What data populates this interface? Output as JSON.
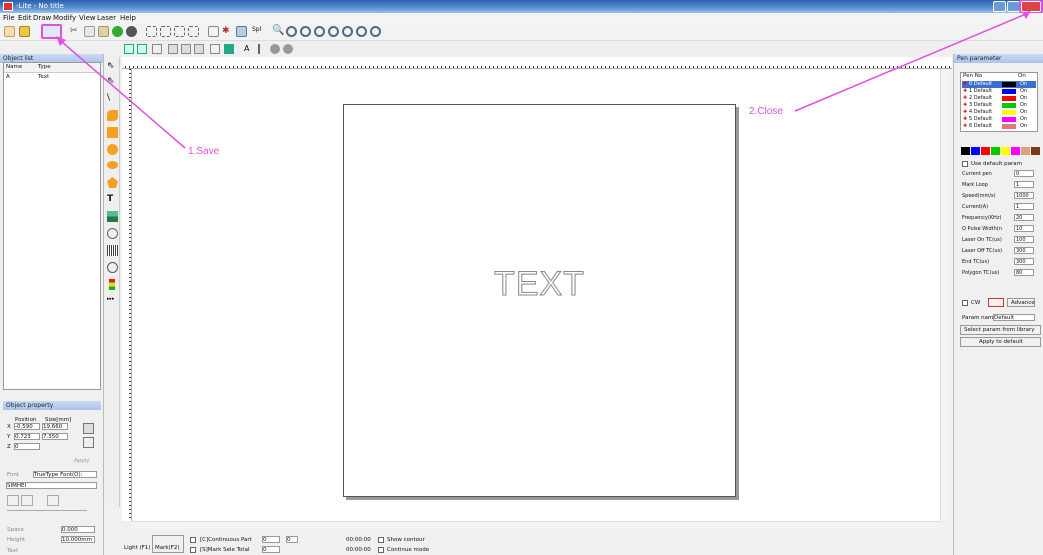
{
  "window": {
    "title": "-Lite - No title"
  },
  "menu": [
    "File",
    "Edit",
    "Draw",
    "Modify",
    "View",
    "Laser",
    "Help"
  ],
  "object_list": {
    "header": "Object list",
    "columns": [
      "Name",
      "Type"
    ],
    "rows": [
      {
        "name": "A",
        "type": "Text"
      }
    ]
  },
  "object_property": {
    "header": "Object property",
    "position_label": "Position",
    "size_label": "Size[mm]",
    "x_label": "X",
    "y_label": "Y",
    "z_label": "Z",
    "x_pos": "-0.590",
    "x_size": "19.660",
    "y_pos": "0.723",
    "y_size": "7.350",
    "z_pos": "0",
    "apply_label": "Apply",
    "font_label": "Font",
    "font_value": "TrueType Font(O):",
    "font_name": "SIMHEI",
    "space_label": "Space",
    "space_value": "0.000",
    "height_label": "Height",
    "height_value": "10.000mm",
    "text_label": "Text"
  },
  "canvas": {
    "object_text": "TEXT"
  },
  "bottom": {
    "light_label": "Light (F1)",
    "mark_label": "Mark(F2)",
    "continuous_label": "[C]Continuous Part",
    "part_value": "0",
    "part_extra": "0",
    "mark_sel_label": "[S]Mark Sele Total",
    "total_value": "0",
    "time1": "00:00:00",
    "time2": "00:00:00",
    "show_contour_label": "Show contour",
    "continue_mode_label": "Continue mode"
  },
  "pen_param": {
    "header": "Pen parameter",
    "columns": [
      "Pen No",
      "",
      "On"
    ],
    "pens": [
      {
        "name": "0 Default",
        "color": "#000000",
        "on": "On"
      },
      {
        "name": "1 Default",
        "color": "#0000ff",
        "on": "On"
      },
      {
        "name": "2 Default",
        "color": "#ff0000",
        "on": "On"
      },
      {
        "name": "3 Default",
        "color": "#00cc00",
        "on": "On"
      },
      {
        "name": "4 Default",
        "color": "#ffff00",
        "on": "On"
      },
      {
        "name": "5 Default",
        "color": "#ff00ff",
        "on": "On"
      },
      {
        "name": "6 Default",
        "color": "#e07a7a",
        "on": "On"
      }
    ],
    "swatches": [
      "#000000",
      "#0000ff",
      "#ff0000",
      "#00cc00",
      "#ffff00",
      "#ff00ff",
      "#e0a080",
      "#7a3b1a"
    ],
    "use_default_label": "Use default param",
    "params": [
      {
        "label": "Current pen",
        "value": "0"
      },
      {
        "label": "Mark Loop",
        "value": "1"
      },
      {
        "label": "Speed(mm/s)",
        "value": "1000"
      },
      {
        "label": "Current(A)",
        "value": "1"
      },
      {
        "label": "Frequency(KHz)",
        "value": "20"
      },
      {
        "label": "Q Pulse Width(n",
        "value": "10"
      },
      {
        "label": "Laser On TC(us)",
        "value": "100"
      },
      {
        "label": "Laser Off TC(us)",
        "value": "300"
      },
      {
        "label": "End TC(us)",
        "value": "300"
      },
      {
        "label": "Polygon TC(us)",
        "value": "80"
      }
    ],
    "cw_label": "CW",
    "advance_label": "Advance",
    "param_name_label": "Param name",
    "param_name_value": "Default",
    "select_library_label": "Select param from library",
    "apply_default_label": "Apply to default"
  },
  "annotations": {
    "save": "1.Save",
    "close": "2.Close"
  },
  "colors": {
    "annotation": "#e050e0",
    "titlebar": "#2b5faa"
  }
}
